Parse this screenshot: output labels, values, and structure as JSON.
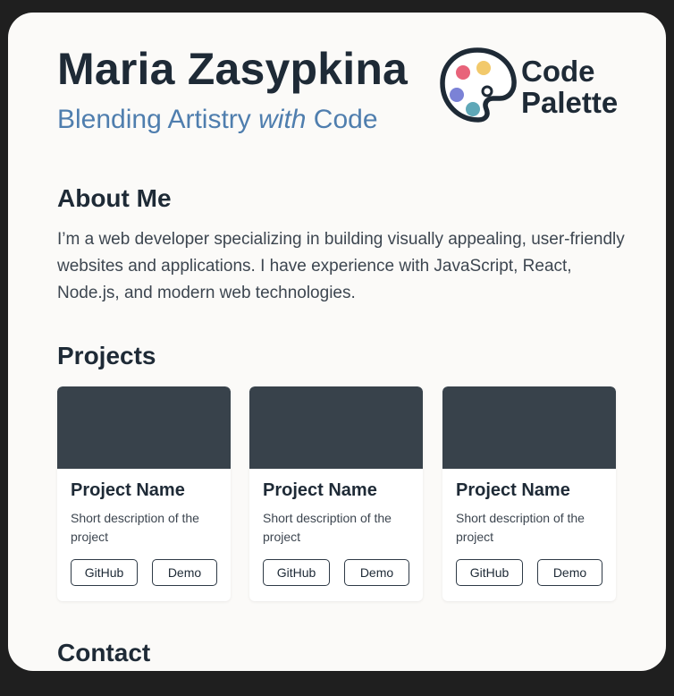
{
  "header": {
    "name": "Maria Zasypkina",
    "tagline_pre": "Blending Artistry ",
    "tagline_em": "with",
    "tagline_post": " Code",
    "logo": {
      "line1": "Code",
      "line2": "Palette",
      "icon": "palette-icon",
      "dot_colors": [
        "#e8637a",
        "#f2c96b",
        "#7b82d6",
        "#5fa8b8"
      ]
    }
  },
  "about": {
    "title": "About Me",
    "text": "I’m a web developer specializing in building visually appealing, user-friendly websites and applications. I have experience with JavaScript, React, Node.js, and modern web technologies."
  },
  "projects": {
    "title": "Projects",
    "items": [
      {
        "name": "Project Name",
        "description": "Short description of the project",
        "github": "GitHub",
        "demo": "Demo"
      },
      {
        "name": "Project Name",
        "description": "Short description of the project",
        "github": "GitHub",
        "demo": "Demo"
      },
      {
        "name": "Project Name",
        "description": "Short description of the project",
        "github": "GitHub",
        "demo": "Demo"
      }
    ]
  },
  "contact": {
    "title": "Contact"
  },
  "colors": {
    "accent": "#4f7eae",
    "heading": "#1e2a36",
    "thumbnail": "#38424b"
  }
}
